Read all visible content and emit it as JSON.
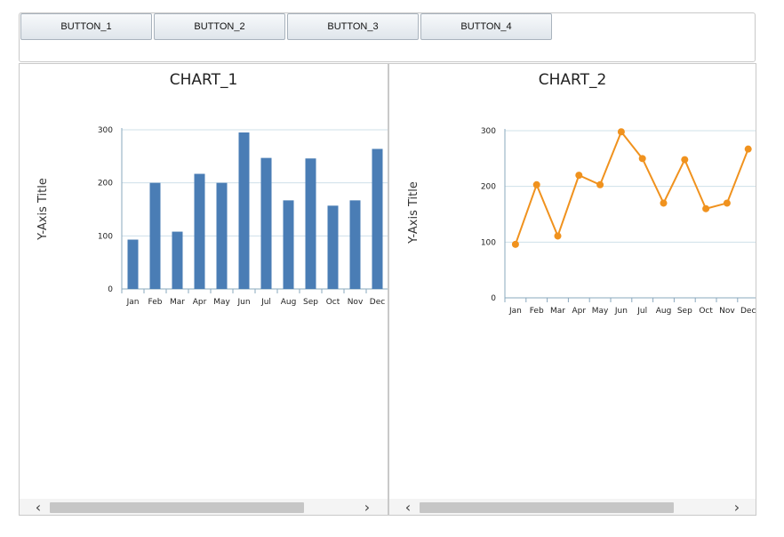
{
  "toolbar": {
    "buttons": [
      "BUTTON_1",
      "BUTTON_2",
      "BUTTON_3",
      "BUTTON_4"
    ]
  },
  "colors": {
    "bar": "#4a7db5",
    "line": "#f0921e",
    "grid": "#cfe0ea",
    "axis": "#8aa8bd"
  },
  "chart_data": [
    {
      "type": "bar",
      "title": "CHART_1",
      "ylabel": "Y-Axis Title",
      "xlabel": "",
      "categories": [
        "Jan",
        "Feb",
        "Mar",
        "Apr",
        "May",
        "Jun",
        "Jul",
        "Aug",
        "Sep",
        "Oct",
        "Nov",
        "Dec"
      ],
      "values": [
        93,
        200,
        108,
        217,
        200,
        295,
        247,
        167,
        246,
        157,
        167,
        264
      ],
      "ylim": [
        0,
        300
      ],
      "yticks": [
        "0",
        "100",
        "200",
        "300"
      ],
      "grid": true,
      "legend": "none"
    },
    {
      "type": "line",
      "title": "CHART_2",
      "ylabel": "Y-Axis Title",
      "xlabel": "",
      "categories": [
        "Jan",
        "Feb",
        "Mar",
        "Apr",
        "May",
        "Jun",
        "Jul",
        "Aug",
        "Sep",
        "Oct",
        "Nov",
        "Dec"
      ],
      "values": [
        96,
        203,
        111,
        220,
        203,
        298,
        250,
        170,
        248,
        160,
        170,
        267
      ],
      "ylim": [
        0,
        300
      ],
      "yticks": [
        "0",
        "100",
        "200",
        "300"
      ],
      "grid": true,
      "legend": "none"
    }
  ]
}
